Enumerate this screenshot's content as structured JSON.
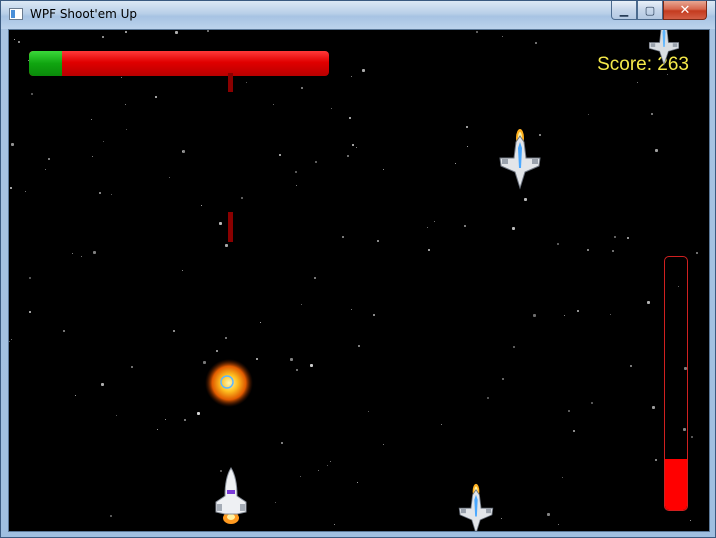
{
  "window": {
    "title": "WPF Shoot'em Up",
    "minimize_glyph": "▁",
    "maximize_glyph": "▢",
    "close_glyph": "✕"
  },
  "hud": {
    "health_fraction": 0.11,
    "score_label": "Score: 263",
    "power_fraction": 0.2
  },
  "colors": {
    "health_remaining": "#10a510",
    "health_lost": "#e00000",
    "score_text": "#f5e94a",
    "power_meter": "#ff0000",
    "laser": "#8a0000"
  },
  "icons": {
    "app": "window-app-icon",
    "player": "player-ship-icon",
    "enemy": "enemy-ship-icon",
    "explosion": "explosion-icon"
  }
}
